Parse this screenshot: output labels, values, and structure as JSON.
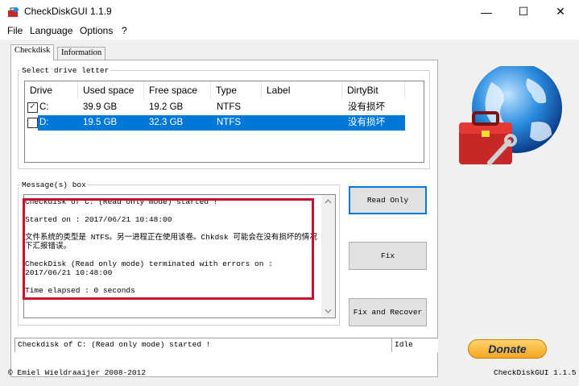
{
  "window": {
    "title": "CheckDiskGUI 1.1.9",
    "minimize": "—",
    "maximize": "☐",
    "close": "✕"
  },
  "menu": [
    "File",
    "Language",
    "Options",
    "?"
  ],
  "tabs": {
    "checkdisk": "Checkdisk",
    "information": "Information"
  },
  "drive_group": {
    "legend": "Select drive letter"
  },
  "drive_table": {
    "columns": [
      "Drive",
      "Used space",
      "Free space",
      "Type",
      "Label",
      "DirtyBit"
    ],
    "rows": [
      {
        "checked": true,
        "drive": "C:",
        "used": "39.9 GB",
        "free": "19.2 GB",
        "type": "NTFS",
        "label": "",
        "dirty": "没有损坏"
      },
      {
        "checked": false,
        "drive": "D:",
        "used": "19.5 GB",
        "free": "32.3 GB",
        "type": "NTFS",
        "label": "",
        "dirty": "没有损坏"
      }
    ]
  },
  "message_group": {
    "legend": "Message(s) box"
  },
  "messages": [
    "Checkdisk of C: (Read only mode) started !",
    "",
    "Started on : 2017/06/21 10:48:00",
    "",
    "文件系统的类型是 NTFS。另一进程正在使用该卷。Chkdsk 可能会在没有损坏的情况下汇报错误。",
    "",
    "CheckDisk (Read only mode) terminated with errors on : 2017/06/21 10:48:00",
    "",
    "Time elapsed : 0 seconds"
  ],
  "buttons": {
    "read_only": "Read Only",
    "fix": "Fix",
    "fix_recover": "Fix and Recover",
    "donate": "Donate"
  },
  "status": {
    "left": "Checkdisk of C: (Read only mode) started !",
    "right": "Idle"
  },
  "footer": {
    "copyright": "© Emiel Wieldraaijer 2008-2012",
    "version": "CheckDiskGUI 1.1.5"
  },
  "colors": {
    "selection": "#0078d7",
    "highlight_border": "#c8102e",
    "donate": "#f6a623"
  }
}
